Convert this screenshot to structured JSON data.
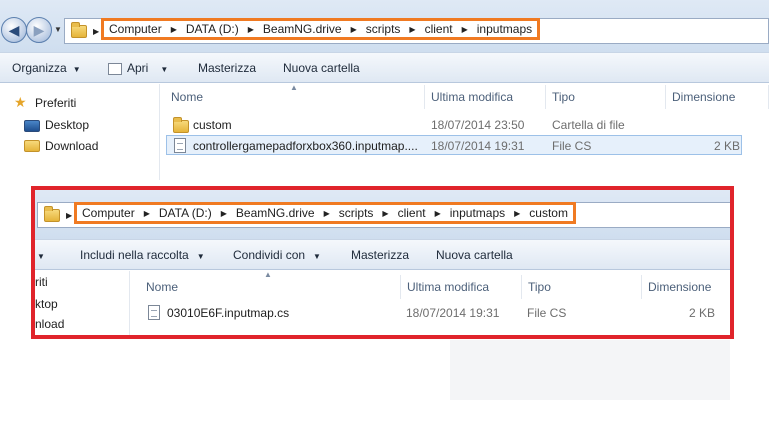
{
  "win1": {
    "nav": {
      "back": "◀",
      "forward": "▶"
    },
    "breadcrumb": [
      "Computer",
      "DATA (D:)",
      "BeamNG.drive",
      "scripts",
      "client",
      "inputmaps"
    ],
    "toolbar": {
      "organize": "Organizza",
      "open": "Apri",
      "burn": "Masterizza",
      "new_folder": "Nuova cartella"
    },
    "sidebar": {
      "favorites": "Preferiti",
      "desktop": "Desktop",
      "downloads": "Download"
    },
    "columns": {
      "name": "Nome",
      "modified": "Ultima modifica",
      "type": "Tipo",
      "size": "Dimensione"
    },
    "rows": [
      {
        "name": "custom",
        "modified": "18/07/2014 23:50",
        "type": "Cartella di file",
        "size": ""
      },
      {
        "name": "controllergamepadforxbox360.inputmap....",
        "modified": "18/07/2014 19:31",
        "type": "File CS",
        "size": "2 KB"
      }
    ]
  },
  "win2": {
    "breadcrumb": [
      "Computer",
      "DATA (D:)",
      "BeamNG.drive",
      "scripts",
      "client",
      "inputmaps",
      "custom"
    ],
    "toolbar": {
      "include": "Includi nella raccolta",
      "share": "Condividi con",
      "burn": "Masterizza",
      "new_folder": "Nuova cartella"
    },
    "sidebar": {
      "favorites": "riti",
      "desktop": "ktop",
      "downloads": "nload"
    },
    "columns": {
      "name": "Nome",
      "modified": "Ultima modifica",
      "type": "Tipo",
      "size": "Dimensione"
    },
    "rows": [
      {
        "name": "03010E6F.inputmap.cs",
        "modified": "18/07/2014 19:31",
        "type": "File CS",
        "size": "2 KB"
      }
    ]
  },
  "colors": {
    "highlight_orange": "#f07a22",
    "highlight_red": "#e0242b",
    "selection": "#e6f0fb"
  },
  "icons": [
    "back-arrow-icon",
    "forward-arrow-icon",
    "folder-icon",
    "file-icon",
    "star-icon",
    "desktop-icon",
    "download-icon"
  ]
}
